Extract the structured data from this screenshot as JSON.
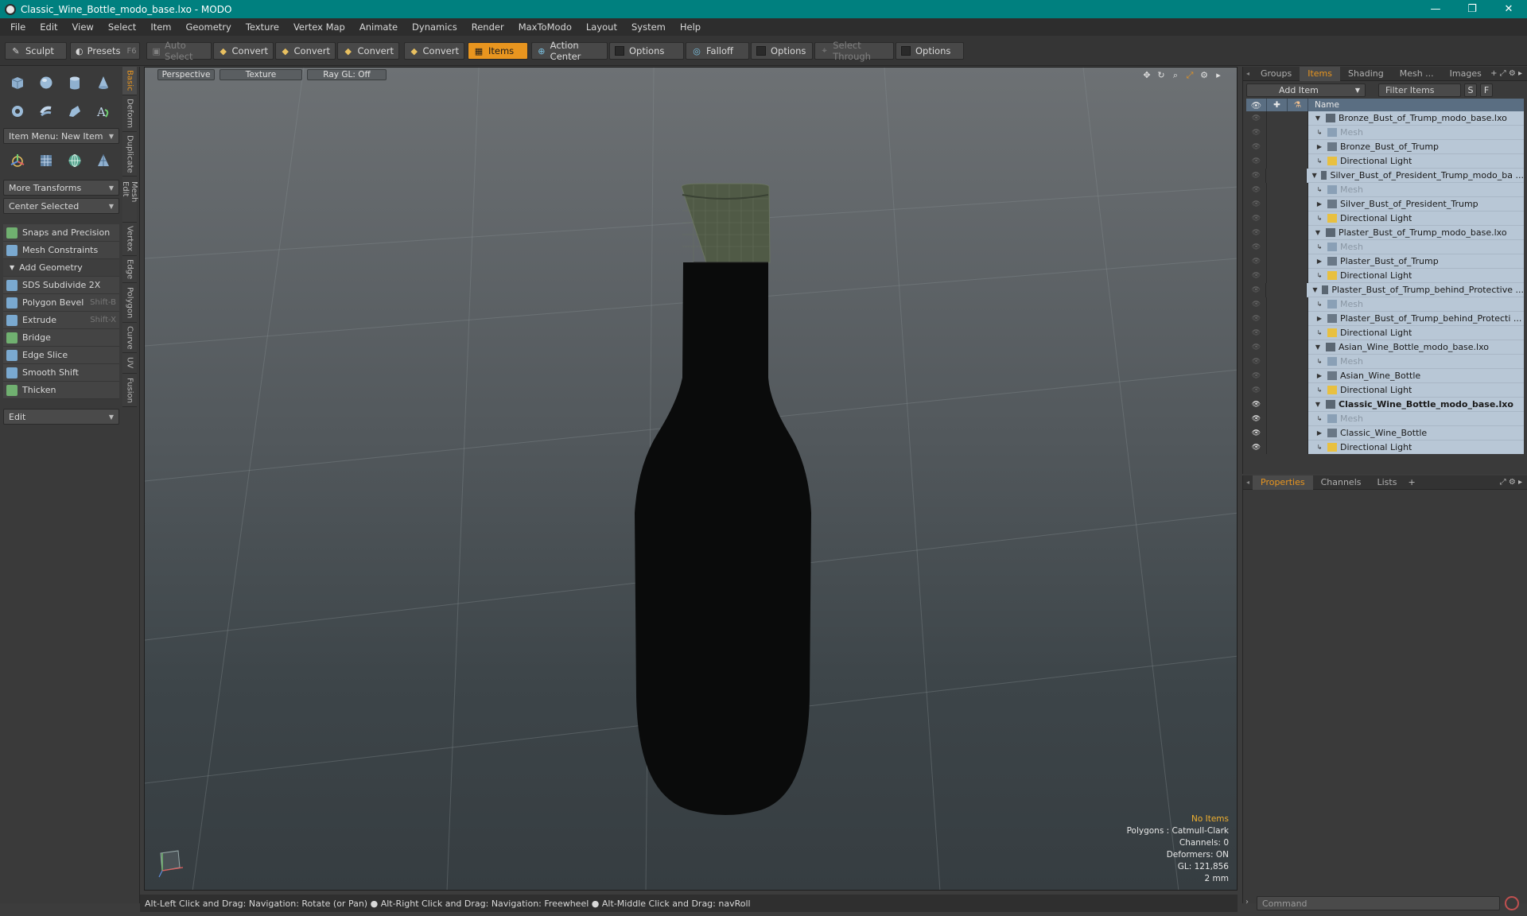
{
  "window": {
    "title": "Classic_Wine_Bottle_modo_base.lxo - MODO",
    "minimize": "—",
    "maximize": "❐",
    "close": "✕"
  },
  "menu": [
    "File",
    "Edit",
    "View",
    "Select",
    "Item",
    "Geometry",
    "Texture",
    "Vertex Map",
    "Animate",
    "Dynamics",
    "Render",
    "MaxToModo",
    "Layout",
    "System",
    "Help"
  ],
  "toolbar": {
    "sculpt": "Sculpt",
    "presets": "Presets",
    "presets_key": "F6",
    "auto_select": "Auto Select",
    "convert1": "Convert",
    "convert2": "Convert",
    "convert3": "Convert",
    "convert4": "Convert",
    "items": "Items",
    "action_center": "Action Center",
    "options1": "Options",
    "falloff": "Falloff",
    "options2": "Options",
    "select_through": "Select Through",
    "options3": "Options"
  },
  "left": {
    "item_menu": "Item Menu: New Item",
    "more_transforms": "More Transforms",
    "center_selected": "Center Selected",
    "snaps": "Snaps and Precision",
    "mesh_constraints": "Mesh Constraints",
    "add_geometry": "Add Geometry",
    "tools": [
      {
        "label": "SDS Subdivide 2X",
        "shortcut": ""
      },
      {
        "label": "Polygon Bevel",
        "shortcut": "Shift-B"
      },
      {
        "label": "Extrude",
        "shortcut": "Shift-X"
      },
      {
        "label": "Bridge",
        "shortcut": ""
      },
      {
        "label": "Edge Slice",
        "shortcut": ""
      },
      {
        "label": "Smooth Shift",
        "shortcut": ""
      },
      {
        "label": "Thicken",
        "shortcut": ""
      }
    ],
    "edit": "Edit",
    "vtabs": [
      "Basic",
      "Deform",
      "Duplicate",
      "Mesh Edit",
      "Vertex",
      "Edge",
      "Polygon",
      "Curve",
      "UV",
      "Fusion"
    ]
  },
  "viewport": {
    "tabs": {
      "perspective": "Perspective",
      "texture": "Texture",
      "raygl": "Ray GL: Off"
    },
    "info": {
      "no_items": "No Items",
      "polygons": "Polygons : Catmull-Clark",
      "channels": "Channels: 0",
      "deformers": "Deformers: ON",
      "gl": "GL: 121,856",
      "scale": "2 mm"
    }
  },
  "items_panel": {
    "tabs": [
      "Groups",
      "Items",
      "Shading",
      "Mesh ...",
      "Images"
    ],
    "add_item": "Add Item",
    "filter": "Filter Items",
    "s_btn": "S",
    "f_btn": "F",
    "col_name": "Name",
    "rows": [
      {
        "label": "Bronze_Bust_of_Trump_modo_base.lxo",
        "level": 0,
        "type": "scene",
        "eye": false
      },
      {
        "label": "Mesh",
        "level": 1,
        "type": "mesh",
        "eye": false
      },
      {
        "label": "Bronze_Bust_of_Trump",
        "level": 1,
        "type": "item",
        "eye": false
      },
      {
        "label": "Directional Light",
        "level": 1,
        "type": "light",
        "eye": false
      },
      {
        "label": "Silver_Bust_of_President_Trump_modo_ba ...",
        "level": 0,
        "type": "scene",
        "eye": false
      },
      {
        "label": "Mesh",
        "level": 1,
        "type": "mesh",
        "eye": false
      },
      {
        "label": "Silver_Bust_of_President_Trump",
        "level": 1,
        "type": "item",
        "eye": false
      },
      {
        "label": "Directional Light",
        "level": 1,
        "type": "light",
        "eye": false
      },
      {
        "label": "Plaster_Bust_of_Trump_modo_base.lxo",
        "level": 0,
        "type": "scene",
        "eye": false
      },
      {
        "label": "Mesh",
        "level": 1,
        "type": "mesh",
        "eye": false
      },
      {
        "label": "Plaster_Bust_of_Trump",
        "level": 1,
        "type": "item",
        "eye": false
      },
      {
        "label": "Directional Light",
        "level": 1,
        "type": "light",
        "eye": false
      },
      {
        "label": "Plaster_Bust_of_Trump_behind_Protective ...",
        "level": 0,
        "type": "scene",
        "eye": false
      },
      {
        "label": "Mesh",
        "level": 1,
        "type": "mesh",
        "eye": false
      },
      {
        "label": "Plaster_Bust_of_Trump_behind_Protecti ...",
        "level": 1,
        "type": "item",
        "eye": false
      },
      {
        "label": "Directional Light",
        "level": 1,
        "type": "light",
        "eye": false
      },
      {
        "label": "Asian_Wine_Bottle_modo_base.lxo",
        "level": 0,
        "type": "scene",
        "eye": false
      },
      {
        "label": "Mesh",
        "level": 1,
        "type": "mesh",
        "eye": false
      },
      {
        "label": "Asian_Wine_Bottle",
        "level": 1,
        "type": "item",
        "eye": false
      },
      {
        "label": "Directional Light",
        "level": 1,
        "type": "light",
        "eye": false
      },
      {
        "label": "Classic_Wine_Bottle_modo_base.lxo",
        "level": 0,
        "type": "scene",
        "eye": true,
        "bold": true
      },
      {
        "label": "Mesh",
        "level": 1,
        "type": "mesh",
        "eye": true
      },
      {
        "label": "Classic_Wine_Bottle",
        "level": 1,
        "type": "item",
        "eye": true
      },
      {
        "label": "Directional Light",
        "level": 1,
        "type": "light",
        "eye": true
      }
    ]
  },
  "props_panel": {
    "tabs": [
      "Properties",
      "Channels",
      "Lists"
    ],
    "command_placeholder": "Command"
  },
  "status": "Alt-Left Click and Drag: Navigation: Rotate (or Pan) ●  Alt-Right Click and Drag: Navigation: Freewheel ●  Alt-Middle Click and Drag: navRoll"
}
